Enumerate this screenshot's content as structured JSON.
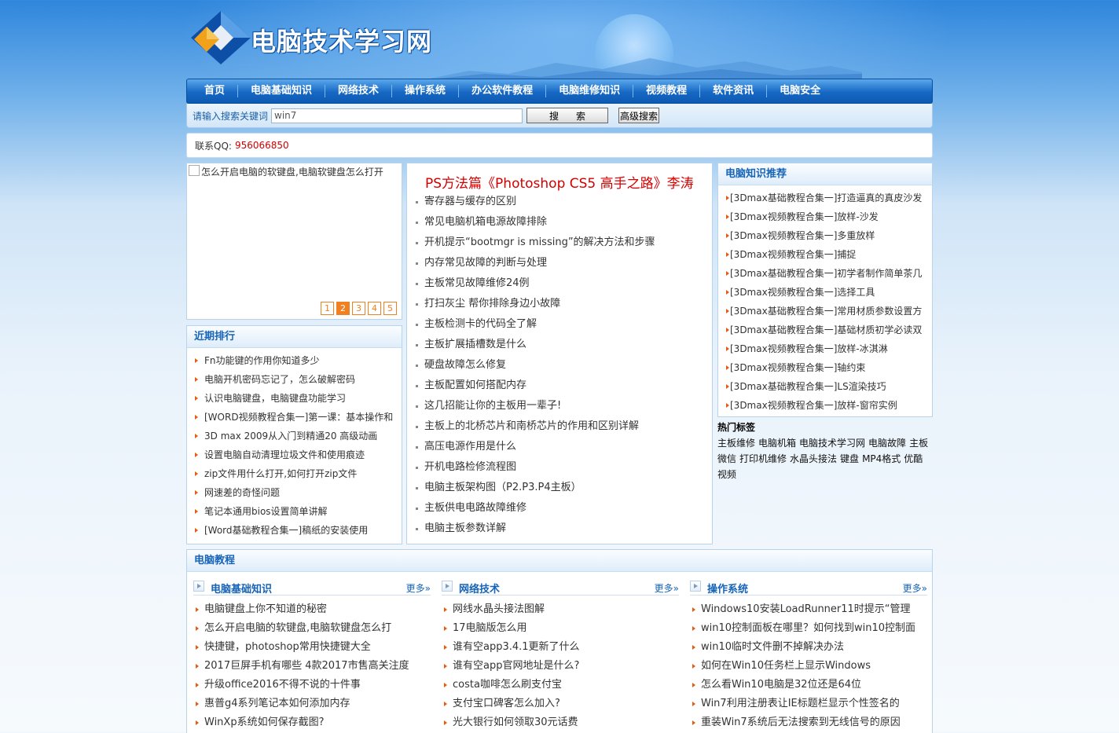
{
  "site": {
    "title": "电脑技术学习网"
  },
  "nav": [
    "首页",
    "电脑基础知识",
    "网络技术",
    "操作系统",
    "办公软件教程",
    "电脑维修知识",
    "视频教程",
    "软件资讯",
    "电脑安全"
  ],
  "search": {
    "label": "请输入搜索关键词",
    "value": "win7",
    "button": "搜索",
    "advanced": "高级搜索"
  },
  "contact": {
    "label": "联系QQ:",
    "qq": "956066850"
  },
  "slider": {
    "image_alt": "怎么开启电脑的软键盘,电脑软键盘怎么打开",
    "pages": [
      "1",
      "2",
      "3",
      "4",
      "5"
    ],
    "active_page": "2"
  },
  "recent": {
    "title": "近期排行",
    "items": [
      "Fn功能键的作用你知道多少",
      "电脑开机密码忘记了，怎么破解密码",
      "认识电脑键盘，电脑键盘功能学习",
      "[WORD视频教程合集一]第一课：基本操作和",
      "3D max 2009从入门到精通20 高级动画",
      "设置电脑自动清理垃圾文件和使用痕迹",
      "zip文件用什么打开,如何打开zip文件",
      "网速差的奇怪问题",
      "笔记本通用bios设置简单讲解",
      "[Word基础教程合集一]稿纸的安装使用"
    ]
  },
  "headline": {
    "title": "PS方法篇《Photoshop CS5 高手之路》李涛",
    "color": "#d40000",
    "items": [
      "寄存器与缓存的区别",
      "常见电脑机箱电源故障排除",
      "开机提示“bootmgr is missing”的解决方法和步骤",
      "内存常见故障的判断与处理",
      "主板常见故障维修24例",
      "打扫灰尘 帮你排除身边小故障",
      "主板检测卡的代码全了解",
      "主板扩展插槽数是什么",
      "硬盘故障怎么修复",
      "主板配置如何搭配内存",
      "这几招能让你的主板用一辈子!",
      "主板上的北桥芯片和南桥芯片的作用和区别详解",
      "高压电源作用是什么",
      "开机电路检修流程图",
      "电脑主板架构图（P2.P3.P4主板）",
      "主板供电电路故障维修",
      "电脑主板参数详解"
    ]
  },
  "recommend": {
    "title": "电脑知识推荐",
    "items": [
      "[3Dmax基础教程合集一]打造逼真的真皮沙发",
      "[3Dmax视频教程合集一]放样-沙发",
      "[3Dmax视频教程合集一]多重放样",
      "[3Dmax视频教程合集一]捕捉",
      "[3Dmax基础教程合集一]初学者制作简单茶几",
      "[3Dmax视频教程合集一]选择工具",
      "[3Dmax基础教程合集一]常用材质参数设置方",
      "[3Dmax基础教程合集一]基础材质初学必读双",
      "[3Dmax视频教程合集一]放样-冰淇淋",
      "[3Dmax视频教程合集一]轴约束",
      "[3Dmax基础教程合集一]LS渲染技巧",
      "[3Dmax视频教程合集一]放样-窗帘实例"
    ]
  },
  "tags": {
    "title": "热门标签",
    "items": [
      "主板维修",
      "电脑机箱",
      "电脑技术学习网",
      "电脑故障",
      "主板",
      "微信",
      "打印机维修",
      "水晶头接法",
      "键盘",
      "MP4格式",
      "优酷",
      "视频"
    ]
  },
  "tutorials": {
    "title": "电脑教程",
    "more": "更多»",
    "columns": [
      {
        "title": "电脑基础知识",
        "items": [
          "电脑键盘上你不知道的秘密",
          "怎么开启电脑的软键盘,电脑软键盘怎么打",
          "快捷键，photoshop常用快捷键大全",
          "2017巨屏手机有哪些 4款2017市售高关注度",
          "升级office2016不得不说的十件事",
          "惠普g4系列笔记本如何添加内存",
          "WinXp系统如何保存截图?"
        ]
      },
      {
        "title": "网络技术",
        "items": [
          "网线水晶头接法图解",
          "17电脑版怎么用",
          "谁有空app3.4.1更新了什么",
          "谁有空app官网地址是什么?",
          "costa咖啡怎么刷支付宝",
          "支付宝口碑客怎么加入?",
          "光大银行如何领取30元话费"
        ]
      },
      {
        "title": "操作系统",
        "items": [
          "Windows10安装LoadRunner11时提示“管理",
          "win10控制面板在哪里？如何找到win10控制面",
          "win10临时文件删不掉解决办法",
          "如何在Win10任务栏上显示Windows",
          "怎么看Win10电脑是32位还是64位",
          "Win7利用注册表让IE标题栏显示个性签名的",
          "重装Win7系统后无法搜索到无线信号的原因"
        ]
      }
    ]
  }
}
